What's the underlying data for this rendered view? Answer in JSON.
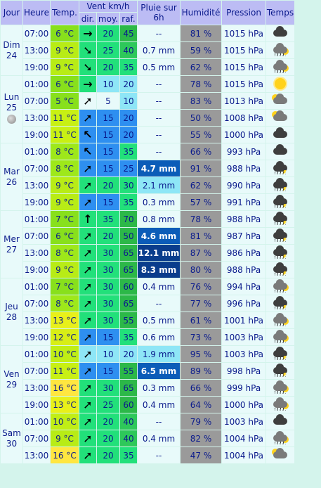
{
  "headers": {
    "jour": "Jour",
    "heure": "Heure",
    "temp": "Temp.",
    "vent": "Vent km/h",
    "vent_dir": "dir.",
    "vent_moy": "moy.",
    "vent_raf": "raf.",
    "pluie": "Pluie sur 6h",
    "humidite": "Humidité",
    "pression": "Pression",
    "temps": "Temps"
  },
  "days": [
    {
      "label": "Dim 24",
      "moon": false,
      "rows": [
        {
          "h": "07:00",
          "t": "6 °C",
          "tc": "#88e01c",
          "dir": "→",
          "dc": "#22e07a",
          "moy": "20",
          "mc": "#22e07a",
          "raf": "45",
          "rc": "#2cb848",
          "rain": "--",
          "rb": "#e8fafa",
          "hum": "81 %",
          "p": "1015 hPa",
          "wx": "cloud"
        },
        {
          "h": "13:00",
          "t": "9 °C",
          "tc": "#b8ec16",
          "dir": "➘",
          "dc": "#22e07a",
          "moy": "25",
          "mc": "#22e07a",
          "raf": "40",
          "rc": "#2ec85a",
          "rain": "0.7 mm",
          "rb": "#e8fafa",
          "hum": "59 %",
          "p": "1015 hPa",
          "wx": "sunrain"
        },
        {
          "h": "19:00",
          "t": "9 °C",
          "tc": "#b8ec16",
          "dir": "➘",
          "dc": "#22e07a",
          "moy": "20",
          "mc": "#22e07a",
          "raf": "35",
          "rc": "#22e07a",
          "rain": "0.5 mm",
          "rb": "#e8fafa",
          "hum": "62 %",
          "p": "1015 hPa",
          "wx": "sunrain"
        }
      ]
    },
    {
      "label": "Lun 25",
      "moon": true,
      "rows": [
        {
          "h": "01:00",
          "t": "6 °C",
          "tc": "#88e01c",
          "dir": "→",
          "dc": "#22e07a",
          "moy": "10",
          "mc": "#8ee6f6",
          "raf": "20",
          "rc": "#8ee6f6",
          "rain": "--",
          "rb": "#e8fafa",
          "hum": "78 %",
          "p": "1015 hPa",
          "wx": "sun"
        },
        {
          "h": "07:00",
          "t": "5 °C",
          "tc": "#88e01c",
          "dir": "➚",
          "dc": "#e8fafa",
          "moy": "5",
          "mc": "#e8fafa",
          "raf": "10",
          "rc": "#8ee6f6",
          "rain": "--",
          "rb": "#e8fafa",
          "hum": "83 %",
          "p": "1013 hPa",
          "wx": "suncloud"
        },
        {
          "h": "13:00",
          "t": "11 °C",
          "tc": "#c8f014",
          "dir": "➚",
          "dc": "#2e8ff0",
          "moy": "15",
          "mc": "#2e8ff0",
          "raf": "20",
          "rc": "#2e8ff0",
          "rain": "--",
          "rb": "#e8fafa",
          "hum": "50 %",
          "p": "1008 hPa",
          "wx": "suncloud"
        },
        {
          "h": "19:00",
          "t": "11 °C",
          "tc": "#c8f014",
          "dir": "↖",
          "dc": "#2e8ff0",
          "moy": "15",
          "mc": "#2e8ff0",
          "raf": "20",
          "rc": "#2e8ff0",
          "rain": "--",
          "rb": "#e8fafa",
          "hum": "55 %",
          "p": "1000 hPa",
          "wx": "cloud"
        }
      ]
    },
    {
      "label": "Mar 26",
      "moon": false,
      "rows": [
        {
          "h": "01:00",
          "t": "8 °C",
          "tc": "#9ee81a",
          "dir": "↖",
          "dc": "#2e8ff0",
          "moy": "15",
          "mc": "#2e8ff0",
          "raf": "35",
          "rc": "#22e07a",
          "rain": "--",
          "rb": "#e8fafa",
          "hum": "66 %",
          "p": "993 hPa",
          "wx": "cloud"
        },
        {
          "h": "07:00",
          "t": "8 °C",
          "tc": "#9ee81a",
          "dir": "➚",
          "dc": "#2e8ff0",
          "moy": "15",
          "mc": "#2e8ff0",
          "raf": "25",
          "rc": "#2e8ff0",
          "rain": "4.7 mm",
          "rb": "#0b5cb8",
          "hum": "91 %",
          "p": "988 hPa",
          "wx": "rain"
        },
        {
          "h": "13:00",
          "t": "9 °C",
          "tc": "#b8ec16",
          "dir": "➚",
          "dc": "#22e07a",
          "moy": "20",
          "mc": "#22e07a",
          "raf": "30",
          "rc": "#22e07a",
          "rain": "2.1 mm",
          "rb": "#8ee6f6",
          "hum": "62 %",
          "p": "990 hPa",
          "wx": "rain"
        },
        {
          "h": "19:00",
          "t": "9 °C",
          "tc": "#b8ec16",
          "dir": "➚",
          "dc": "#2e8ff0",
          "moy": "15",
          "mc": "#2e8ff0",
          "raf": "35",
          "rc": "#22e07a",
          "rain": "0.3 mm",
          "rb": "#e8fafa",
          "hum": "57 %",
          "p": "991 hPa",
          "wx": "rain"
        }
      ]
    },
    {
      "label": "Mer 27",
      "moon": false,
      "rows": [
        {
          "h": "01:00",
          "t": "7 °C",
          "tc": "#88e01c",
          "dir": "↑",
          "dc": "#22e07a",
          "moy": "35",
          "mc": "#22e07a",
          "raf": "70",
          "rc": "#2cb848",
          "rain": "0.8 mm",
          "rb": "#e8fafa",
          "hum": "78 %",
          "p": "988 hPa",
          "wx": "rain"
        },
        {
          "h": "07:00",
          "t": "6 °C",
          "tc": "#88e01c",
          "dir": "➚",
          "dc": "#22e07a",
          "moy": "20",
          "mc": "#22e07a",
          "raf": "50",
          "rc": "#2cb848",
          "rain": "4.6 mm",
          "rb": "#0b5cb8",
          "hum": "81 %",
          "p": "987 hPa",
          "wx": "rain"
        },
        {
          "h": "13:00",
          "t": "8 °C",
          "tc": "#9ee81a",
          "dir": "➚",
          "dc": "#22e07a",
          "moy": "30",
          "mc": "#22e07a",
          "raf": "65",
          "rc": "#2cb848",
          "rain": "12.1 mm",
          "rb": "#0a3d8c",
          "hum": "87 %",
          "p": "986 hPa",
          "wx": "rain"
        },
        {
          "h": "19:00",
          "t": "9 °C",
          "tc": "#b8ec16",
          "dir": "➚",
          "dc": "#22e07a",
          "moy": "30",
          "mc": "#22e07a",
          "raf": "65",
          "rc": "#2cb848",
          "rain": "8.3 mm",
          "rb": "#0a3d8c",
          "hum": "80 %",
          "p": "988 hPa",
          "wx": "rain"
        }
      ]
    },
    {
      "label": "Jeu 28",
      "moon": false,
      "rows": [
        {
          "h": "01:00",
          "t": "7 °C",
          "tc": "#88e01c",
          "dir": "➚",
          "dc": "#22e07a",
          "moy": "30",
          "mc": "#22e07a",
          "raf": "60",
          "rc": "#2cb848",
          "rain": "0.4 mm",
          "rb": "#e8fafa",
          "hum": "76 %",
          "p": "994 hPa",
          "wx": "sunrain"
        },
        {
          "h": "07:00",
          "t": "8 °C",
          "tc": "#9ee81a",
          "dir": "➚",
          "dc": "#22e07a",
          "moy": "30",
          "mc": "#22e07a",
          "raf": "65",
          "rc": "#2cb848",
          "rain": "--",
          "rb": "#e8fafa",
          "hum": "77 %",
          "p": "996 hPa",
          "wx": "rain"
        },
        {
          "h": "13:00",
          "t": "13 °C",
          "tc": "#e8f01a",
          "dir": "➚",
          "dc": "#22e07a",
          "moy": "30",
          "mc": "#22e07a",
          "raf": "55",
          "rc": "#2cb848",
          "rain": "0.5 mm",
          "rb": "#e8fafa",
          "hum": "61 %",
          "p": "1001 hPa",
          "wx": "sunrain"
        },
        {
          "h": "19:00",
          "t": "12 °C",
          "tc": "#d8ee16",
          "dir": "➚",
          "dc": "#2e8ff0",
          "moy": "15",
          "mc": "#2e8ff0",
          "raf": "35",
          "rc": "#22e07a",
          "rain": "0.6 mm",
          "rb": "#e8fafa",
          "hum": "73 %",
          "p": "1003 hPa",
          "wx": "sunrain"
        }
      ]
    },
    {
      "label": "Ven 29",
      "moon": false,
      "rows": [
        {
          "h": "01:00",
          "t": "10 °C",
          "tc": "#c0ee16",
          "dir": "➚",
          "dc": "#8ee6f6",
          "moy": "10",
          "mc": "#8ee6f6",
          "raf": "20",
          "rc": "#8ee6f6",
          "rain": "1.9 mm",
          "rb": "#8ee6f6",
          "hum": "95 %",
          "p": "1003 hPa",
          "wx": "rain"
        },
        {
          "h": "07:00",
          "t": "11 °C",
          "tc": "#c8f014",
          "dir": "➚",
          "dc": "#2e8ff0",
          "moy": "15",
          "mc": "#2e8ff0",
          "raf": "55",
          "rc": "#2cb848",
          "rain": "6.5 mm",
          "rb": "#0b5cb8",
          "hum": "89 %",
          "p": "998 hPa",
          "wx": "rain"
        },
        {
          "h": "13:00",
          "t": "16 °C",
          "tc": "#ffe640",
          "dir": "➚",
          "dc": "#22e07a",
          "moy": "30",
          "mc": "#22e07a",
          "raf": "65",
          "rc": "#2cb848",
          "rain": "0.3 mm",
          "rb": "#e8fafa",
          "hum": "66 %",
          "p": "999 hPa",
          "wx": "sunrain"
        },
        {
          "h": "19:00",
          "t": "13 °C",
          "tc": "#e8f01a",
          "dir": "➚",
          "dc": "#22e07a",
          "moy": "25",
          "mc": "#22e07a",
          "raf": "60",
          "rc": "#2cb848",
          "rain": "0.4 mm",
          "rb": "#e8fafa",
          "hum": "64 %",
          "p": "1000 hPa",
          "wx": "sunrain"
        }
      ]
    },
    {
      "label": "Sam 30",
      "moon": false,
      "rows": [
        {
          "h": "01:00",
          "t": "10 °C",
          "tc": "#c0ee16",
          "dir": "➚",
          "dc": "#22e07a",
          "moy": "20",
          "mc": "#22e07a",
          "raf": "40",
          "rc": "#2ec85a",
          "rain": "--",
          "rb": "#e8fafa",
          "hum": "79 %",
          "p": "1003 hPa",
          "wx": "cloud"
        },
        {
          "h": "07:00",
          "t": "9 °C",
          "tc": "#b8ec16",
          "dir": "➚",
          "dc": "#22e07a",
          "moy": "20",
          "mc": "#22e07a",
          "raf": "40",
          "rc": "#2ec85a",
          "rain": "0.4 mm",
          "rb": "#e8fafa",
          "hum": "82 %",
          "p": "1004 hPa",
          "wx": "sunrain"
        },
        {
          "h": "13:00",
          "t": "16 °C",
          "tc": "#ffe640",
          "dir": "➚",
          "dc": "#22e07a",
          "moy": "20",
          "mc": "#22e07a",
          "raf": "35",
          "rc": "#22e07a",
          "rain": "--",
          "rb": "#e8fafa",
          "hum": "47 %",
          "p": "1004 hPa",
          "wx": "suncloud"
        }
      ]
    }
  ]
}
